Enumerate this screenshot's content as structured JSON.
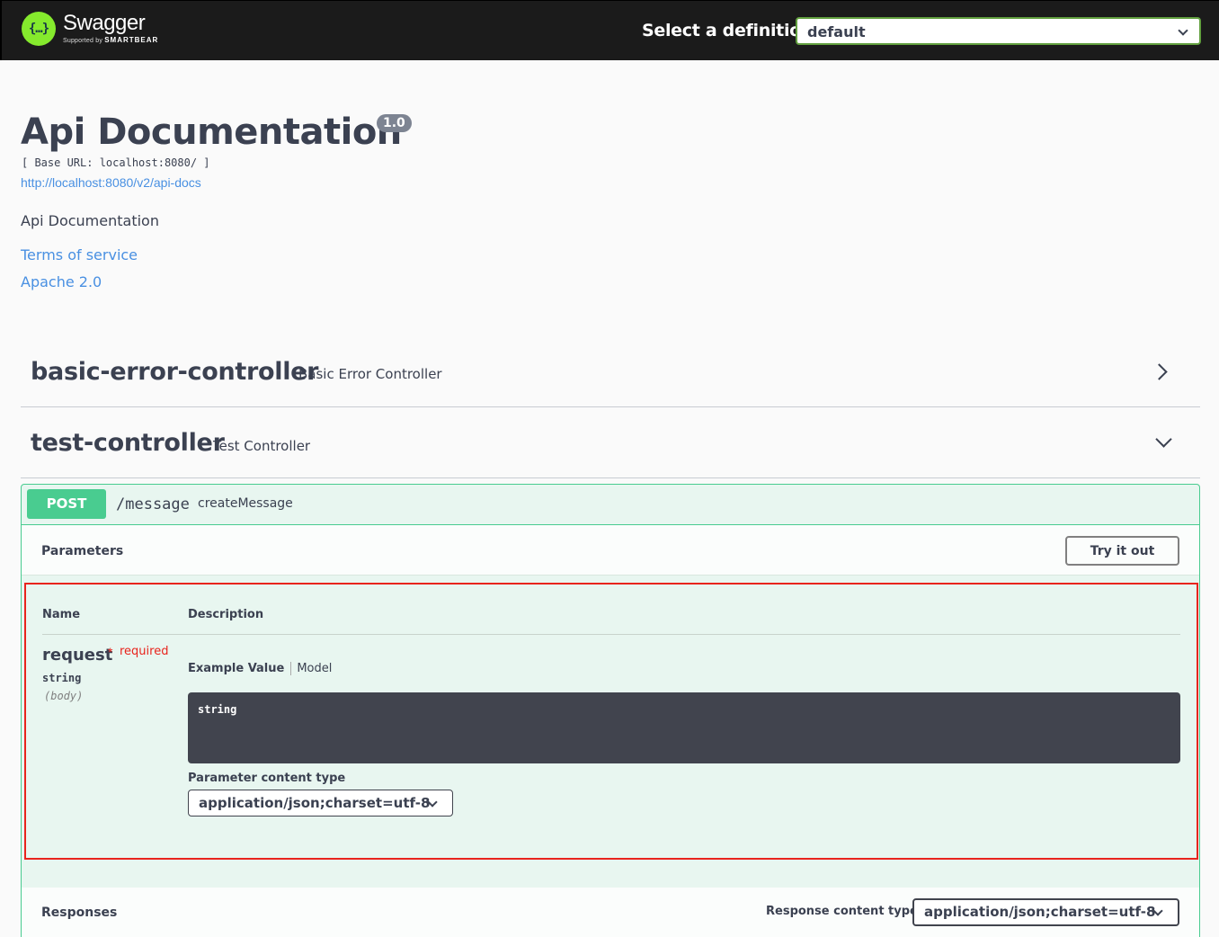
{
  "topbar": {
    "logo_name": "Swagger",
    "logo_sub_prefix": "Supported by",
    "logo_sub_brand": "SMARTBEAR",
    "definition_label": "Select a definition",
    "definition_value": "default"
  },
  "info": {
    "title": "Api Documentation",
    "version": "1.0",
    "base_url": "[ Base URL: localhost:8080/ ]",
    "api_docs_link": "http://localhost:8080/v2/api-docs",
    "description": "Api Documentation",
    "terms": "Terms of service",
    "license": "Apache 2.0"
  },
  "tags": [
    {
      "name": "basic-error-controller",
      "description": "Basic Error Controller",
      "expanded": false
    },
    {
      "name": "test-controller",
      "description": "Test Controller",
      "expanded": true
    }
  ],
  "operation": {
    "method": "POST",
    "path": "/message",
    "summary": "createMessage",
    "parameters_title": "Parameters",
    "try_button": "Try it out",
    "col_name": "Name",
    "col_description": "Description",
    "param": {
      "name": "request",
      "required_star": "*",
      "required_label": "required",
      "type": "string",
      "in": "(body)"
    },
    "tab_example": "Example Value",
    "tab_model": "Model",
    "example_value": "string",
    "content_type_label": "Parameter content type",
    "content_type_value": "application/json;charset=utf-8",
    "responses_title": "Responses",
    "response_ct_label": "Response content type",
    "response_ct_value": "application/json;charset=utf-8"
  },
  "colors": {
    "topbar": "#1b1b1b",
    "accent_green": "#49cc90",
    "link": "#4990e2",
    "required": "#e8241d",
    "highlight_border": "#e8241d"
  }
}
